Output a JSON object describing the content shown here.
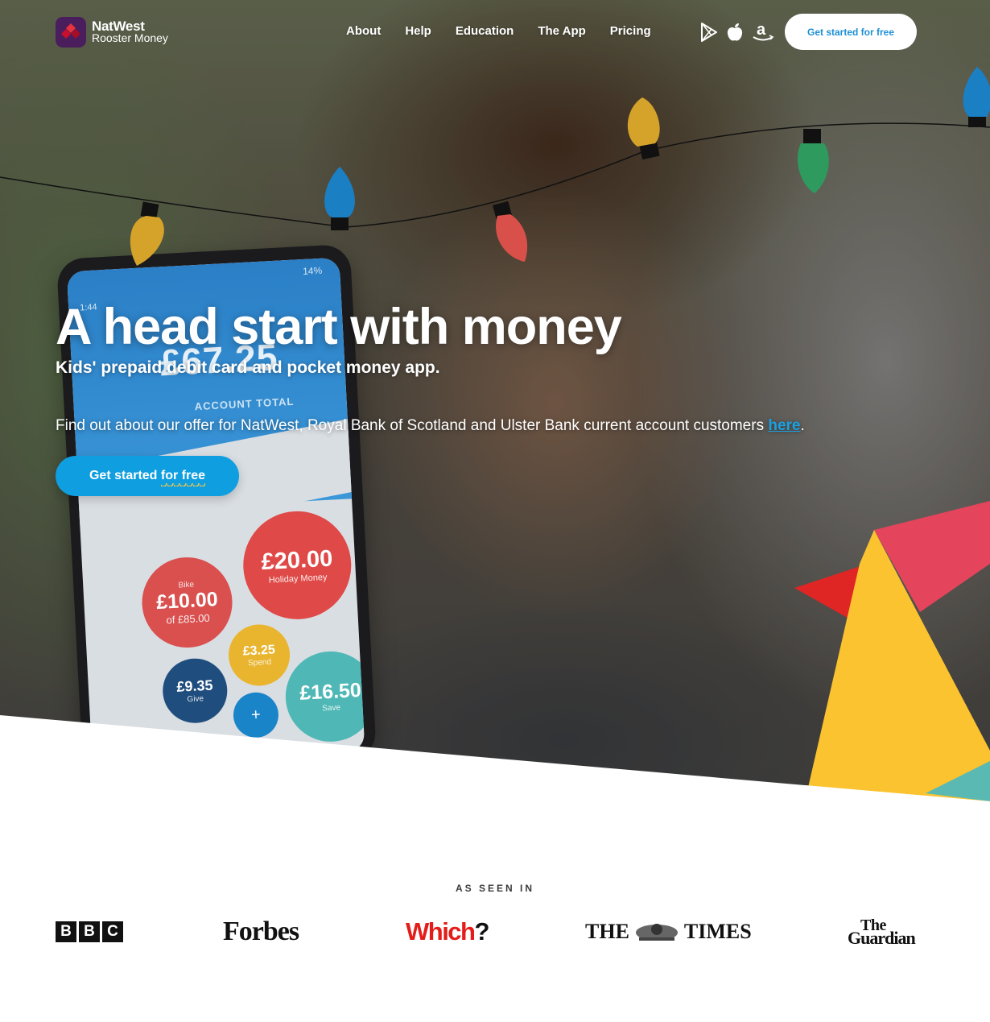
{
  "brand": {
    "line1": "NatWest",
    "line2": "Rooster Money"
  },
  "nav": {
    "links": [
      "About",
      "Help",
      "Education",
      "The App",
      "Pricing"
    ],
    "store_icons": [
      "google-play-icon",
      "apple-icon",
      "amazon-icon"
    ],
    "cta": "Get started for free"
  },
  "hero": {
    "headline": "A head start with money",
    "subhead": "Kids' prepaid debit card and pocket money app.",
    "offer_text": "Find out about our offer for NatWest, Royal Bank of Scotland and Ulster Bank current account customers ",
    "offer_link": "here",
    "offer_end": ".",
    "cta_part1": "Get started ",
    "cta_part2": "for free"
  },
  "phone": {
    "status": "14%",
    "time": "1:44",
    "balance": "£67.25",
    "caption": "ACCOUNT TOTAL",
    "pots": [
      {
        "label": "Bike",
        "amount": "£10.00",
        "sub": "of £85.00",
        "color": "#d9504f"
      },
      {
        "label": "",
        "amount": "£20.00",
        "sub": "Holiday Money",
        "color": "#df4a48"
      },
      {
        "label": "",
        "amount": "£3.25",
        "sub": "Spend",
        "color": "#e9b52f"
      },
      {
        "label": "",
        "amount": "£9.35",
        "sub": "Give",
        "color": "#1f4d7d"
      },
      {
        "label": "",
        "amount": "+",
        "sub": "",
        "color": "#1a84c9"
      },
      {
        "label": "",
        "amount": "£16.50",
        "sub": "Save",
        "color": "#4fb8b6"
      }
    ]
  },
  "colors": {
    "accent": "#0f9ee0",
    "link": "#1aa1e2",
    "bulb_yellow": "#d6a32a",
    "bulb_blue": "#1b7fc4",
    "bulb_red": "#d9504b",
    "bulb_green": "#2e9a5e",
    "shape_red": "#e4455c",
    "shape_yellow": "#fbc330",
    "shape_teal": "#5ab9b2"
  },
  "press": {
    "title": "AS SEEN IN",
    "bbc": [
      "B",
      "B",
      "C"
    ],
    "forbes": "Forbes",
    "which": "Which",
    "which_q": "?",
    "times_left": "THE",
    "times_right": "TIMES",
    "guardian_1": "The",
    "guardian_2": "Guardian"
  }
}
